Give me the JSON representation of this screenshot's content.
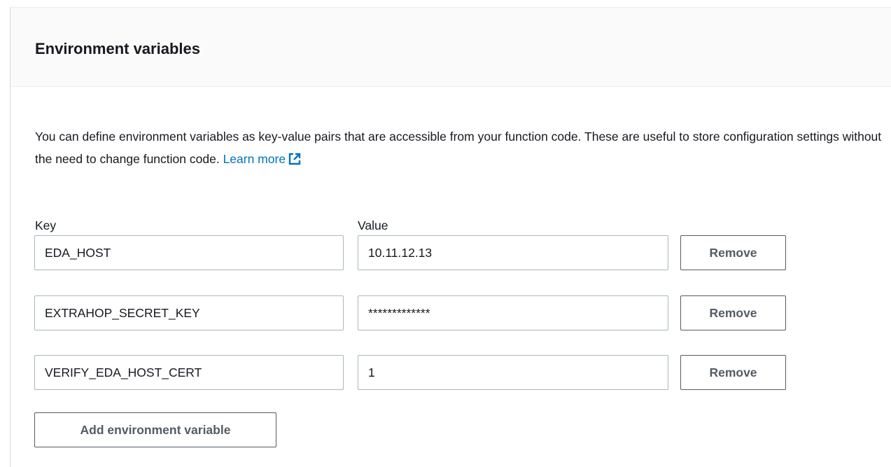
{
  "section": {
    "title": "Environment variables",
    "description": "You can define environment variables as key-value pairs that are accessible from your function code. These are useful to store configuration settings without the need to change function code.",
    "learn_more_label": "Learn more"
  },
  "columns": {
    "key_label": "Key",
    "value_label": "Value"
  },
  "variables": [
    {
      "key": "EDA_HOST",
      "value": "10.11.12.13",
      "remove_label": "Remove"
    },
    {
      "key": "EXTRAHOP_SECRET_KEY",
      "value": "*************",
      "remove_label": "Remove"
    },
    {
      "key": "VERIFY_EDA_HOST_CERT",
      "value": "1",
      "remove_label": "Remove"
    }
  ],
  "add_button_label": "Add environment variable",
  "colors": {
    "link": "#0073bb",
    "button_text": "#545b64",
    "input_border": "#aab7b8",
    "header_bg": "#fafafa"
  },
  "icons": {
    "learn_more": "external-link-icon"
  }
}
